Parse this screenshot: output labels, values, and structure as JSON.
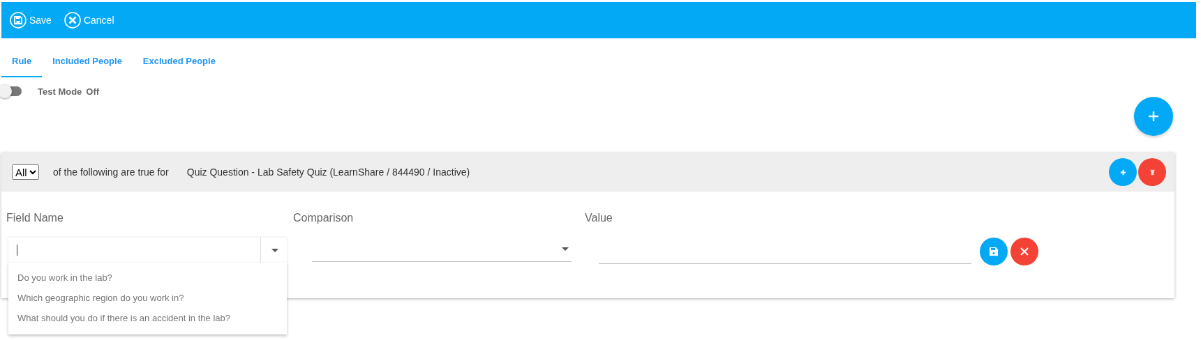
{
  "toolbar": {
    "buttons": [
      {
        "label": "Save",
        "kind": "save"
      },
      {
        "label": "Cancel",
        "kind": "cancel"
      }
    ]
  },
  "tabs": [
    {
      "label": "Rule",
      "selected": true
    },
    {
      "label": "Included People",
      "selected": false
    },
    {
      "label": "Excluded People",
      "selected": false
    }
  ],
  "test_mode": {
    "label": "Test Mode",
    "state": "Off",
    "on": false
  },
  "rule": {
    "quantifier": "All",
    "connector": "of the following are true for",
    "target": "Quiz Question - Lab Safety Quiz (LearnShare / 844490 / Inactive)",
    "columns": [
      "Field Name",
      "Comparison",
      "Value"
    ],
    "field_name": {
      "expanded": true,
      "options": [
        "Do you work in the lab?",
        "Which geographic region do you work in?",
        "What should you do if there is an accident in the lab?"
      ]
    }
  }
}
